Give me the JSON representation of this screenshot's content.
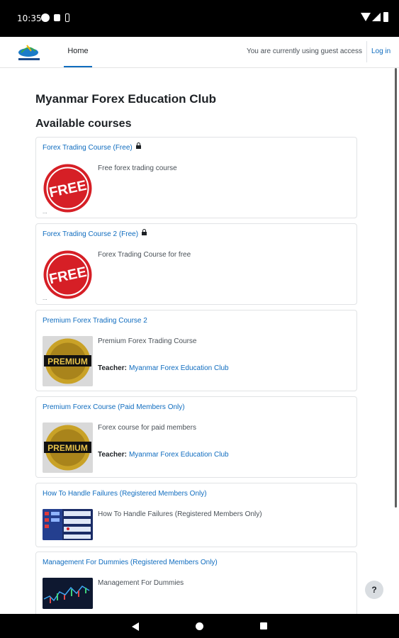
{
  "status_bar": {
    "time": "10:35"
  },
  "header": {
    "nav_home": "Home",
    "guest_notice": "You are currently using guest access",
    "login_link": "Log in"
  },
  "main": {
    "site_title": "Myanmar Forex Education Club",
    "section_title": "Available courses",
    "courses": [
      {
        "name": "Forex Trading Course (Free)",
        "summary": "Free forex trading course",
        "image_icon": "free-badge",
        "locked": true
      },
      {
        "name": "Forex Trading Course 2 (Free)",
        "summary": "Forex Trading Course for free",
        "image_icon": "free-badge",
        "locked": true
      },
      {
        "name": "Premium Forex Trading Course 2",
        "summary": "Premium Forex Trading Course",
        "image_icon": "premium-badge",
        "teacher_label": "Teacher:",
        "teacher_name": "Myanmar Forex Education Club"
      },
      {
        "name": "Premium Forex Course (Paid Members Only)",
        "summary": "Forex course for paid members",
        "image_icon": "premium-badge",
        "teacher_label": "Teacher:",
        "teacher_name": "Myanmar Forex Education Club"
      },
      {
        "name": "How To Handle Failures (Registered Members Only)",
        "summary": "How To Handle Failures (Registered Members Only)",
        "image_icon": "currency-photo"
      },
      {
        "name": "Management For Dummies (Registered Members Only)",
        "summary": "Management For Dummies",
        "image_icon": "chart-photo"
      }
    ],
    "badge_text_free": "FREE",
    "badge_text_premium": "PREMIUM",
    "ellipsis": "..."
  },
  "help": {
    "label": "?"
  },
  "colors": {
    "link": "#0f6cbf",
    "text": "#1d2125",
    "free_red": "#d61f26",
    "premium_gold": "#c9a227"
  }
}
